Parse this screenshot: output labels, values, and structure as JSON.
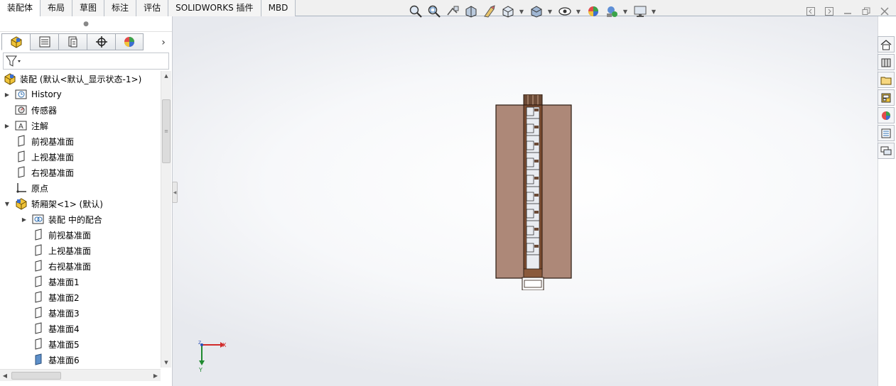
{
  "tabs": [
    "装配体",
    "布局",
    "草图",
    "标注",
    "评估",
    "SOLIDWORKS 插件",
    "MBD"
  ],
  "active_tab": 0,
  "view_toolbar": {
    "icons": [
      "zoom-to-fit-icon",
      "zoom-area-icon",
      "previous-view-icon",
      "section-view-icon",
      "dynamic-annotation-icon",
      "view-orientation-icon",
      "display-style-icon",
      "hide-show-items-icon",
      "edit-appearance-icon",
      "apply-scene-icon",
      "view-settings-icon"
    ]
  },
  "panel_tabs": [
    "featuremanager-icon",
    "propertymanager-icon",
    "configurationmanager-icon",
    "dimxpertmanager-icon",
    "displaymanager-icon"
  ],
  "tree": [
    {
      "label": "装配  (默认<默认_显示状态-1>)",
      "icon": "assembly-icon",
      "indent": 0,
      "expander": ""
    },
    {
      "label": "History",
      "icon": "history-icon",
      "indent": 1,
      "expander": "right"
    },
    {
      "label": "传感器",
      "icon": "sensor-icon",
      "indent": 1,
      "expander": ""
    },
    {
      "label": "注解",
      "icon": "annotation-icon",
      "indent": 1,
      "expander": "right"
    },
    {
      "label": "前视基准面",
      "icon": "plane-icon",
      "indent": 1,
      "expander": ""
    },
    {
      "label": "上视基准面",
      "icon": "plane-icon",
      "indent": 1,
      "expander": ""
    },
    {
      "label": "右视基准面",
      "icon": "plane-icon",
      "indent": 1,
      "expander": ""
    },
    {
      "label": "原点",
      "icon": "origin-icon",
      "indent": 1,
      "expander": ""
    },
    {
      "label": "轿厢架<1> (默认)",
      "icon": "subassembly-icon",
      "indent": 1,
      "expander": "down"
    },
    {
      "label": "装配 中的配合",
      "icon": "mates-icon",
      "indent": 2,
      "expander": "right"
    },
    {
      "label": "前视基准面",
      "icon": "plane-icon",
      "indent": 2,
      "expander": ""
    },
    {
      "label": "上视基准面",
      "icon": "plane-icon",
      "indent": 2,
      "expander": ""
    },
    {
      "label": "右视基准面",
      "icon": "plane-icon",
      "indent": 2,
      "expander": ""
    },
    {
      "label": "基准面1",
      "icon": "plane-icon",
      "indent": 2,
      "expander": ""
    },
    {
      "label": "基准面2",
      "icon": "plane-icon",
      "indent": 2,
      "expander": ""
    },
    {
      "label": "基准面3",
      "icon": "plane-icon",
      "indent": 2,
      "expander": ""
    },
    {
      "label": "基准面4",
      "icon": "plane-icon",
      "indent": 2,
      "expander": ""
    },
    {
      "label": "基准面5",
      "icon": "plane-icon",
      "indent": 2,
      "expander": ""
    },
    {
      "label": "基准面6",
      "icon": "plane-filled-icon",
      "indent": 2,
      "expander": ""
    }
  ],
  "triad": {
    "x_label": "X",
    "y_label": "Y",
    "z_label": "Z"
  },
  "task_pane": [
    "home-icon",
    "design-library-icon",
    "file-explorer-icon",
    "view-palette-icon",
    "appearances-icon",
    "custom-properties-icon",
    "forum-icon"
  ],
  "colors": {
    "model_body": "#ad8878",
    "model_column": "#8a5a3c",
    "accent": "#2b6cb0"
  }
}
